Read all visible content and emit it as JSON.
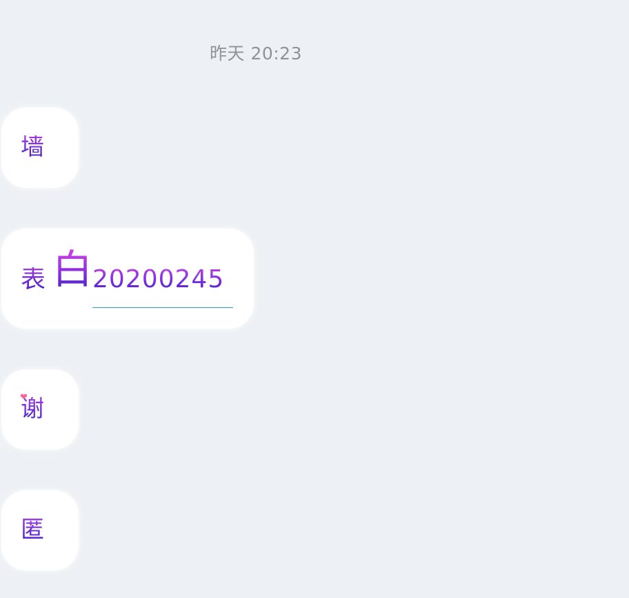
{
  "timestamp": "昨天 20:23",
  "messages": [
    {
      "text": "墙"
    },
    {
      "prefix": "表",
      "emphasis": "白",
      "number": "20200245"
    },
    {
      "text": "谢",
      "icon": "heart-icon"
    },
    {
      "text": "匿"
    }
  ],
  "colors": {
    "background": "#edf0f4",
    "bubble": "#ffffff",
    "text_gradient_top": "#a23fe0",
    "text_gradient_bottom": "#4b25c7",
    "link_underline": "#2f9fbf",
    "timestamp": "#8f9399"
  }
}
